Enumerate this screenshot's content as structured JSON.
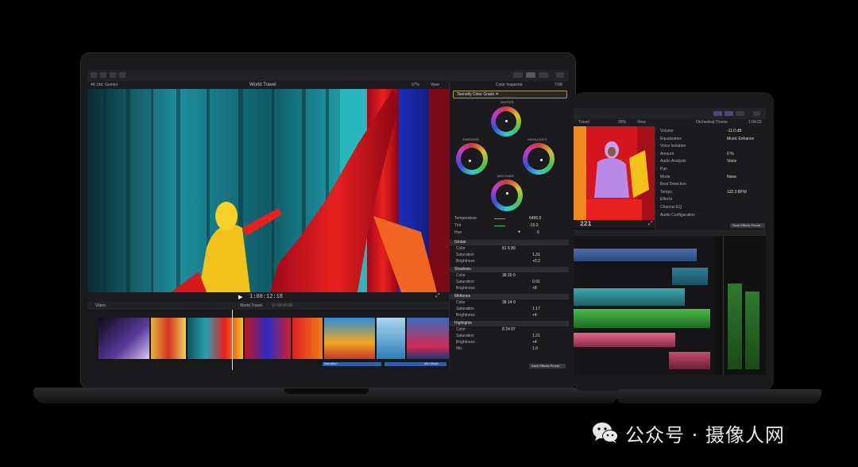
{
  "large_screen": {
    "toolbar": {
      "library": "4K Utd. Gemini",
      "project": "World Travel",
      "zoom": "67%",
      "view": "View",
      "inspector_title": "Color Inspector",
      "inspector_time": "7:08"
    },
    "color_preset": "Teenetly Color Grade ≑",
    "wheels": {
      "master": "MASTER",
      "shadows": "SHADOWS",
      "highlights": "HIGHLIGHTS",
      "midtones": "MIDTONES"
    },
    "params": [
      {
        "label": "Temperature",
        "value": "6495.0"
      },
      {
        "label": "Tint",
        "value": "-15.0"
      },
      {
        "label": "Hue",
        "value": "0"
      }
    ],
    "sections": [
      {
        "title": "Global",
        "rows": [
          {
            "label": "Color",
            "values": "81   6   80"
          },
          {
            "label": "Saturation",
            "values": "1.31"
          },
          {
            "label": "Brightness",
            "values": "+0.2"
          }
        ]
      },
      {
        "title": "Shadows",
        "rows": [
          {
            "label": "Color",
            "values": "38   20   0"
          },
          {
            "label": "Saturation",
            "values": "0.91"
          },
          {
            "label": "Brightness",
            "values": "+8"
          }
        ]
      },
      {
        "title": "Midtones",
        "rows": [
          {
            "label": "Color",
            "values": "38   14   0"
          },
          {
            "label": "Saturation",
            "values": "1.17"
          },
          {
            "label": "Brightness",
            "values": "+4"
          }
        ]
      },
      {
        "title": "Highlights",
        "rows": [
          {
            "label": "Color",
            "values": "8   24   97"
          },
          {
            "label": "Saturation",
            "values": "1.21"
          },
          {
            "label": "Brightness",
            "values": "+4"
          },
          {
            "label": "Mix",
            "values": "1.0"
          }
        ]
      }
    ],
    "save_preset": "Save Effects Preset",
    "timecode": "1:00:12:18",
    "timeline": {
      "label": "Video",
      "project": "World Travel",
      "duration": "27:00:00:00",
      "tag_left": "Narration",
      "tag_right": "Mtn Music"
    }
  },
  "small_screen": {
    "toolbar": {
      "name": "Travel",
      "zoom": "29%",
      "view": "View",
      "title": "Orchestral Theme",
      "time": "1:04:22"
    },
    "inspector_rows": [
      {
        "label": "Volume",
        "value": "-11.0 dB"
      },
      {
        "label": "Equalization",
        "value": "Music Enhance"
      },
      {
        "label": "Voice Isolation",
        "value": ""
      },
      {
        "label": "Amount",
        "value": "0 %"
      },
      {
        "label": "Audio Analysis",
        "value": "Voice"
      },
      {
        "label": "Pan",
        "value": ""
      },
      {
        "label": "Mode",
        "value": "None"
      },
      {
        "label": "Beat Detection",
        "value": ""
      },
      {
        "label": "Tempo",
        "value": "132.0 BPM"
      },
      {
        "label": "Effects",
        "value": ""
      },
      {
        "label": "Channel EQ",
        "value": ""
      },
      {
        "label": "Audio Configuration",
        "value": ""
      }
    ],
    "save_preset": "Save Effects Preset",
    "timecode": "221"
  },
  "watermark": {
    "text": "公众号 · 摄像人网",
    "icon": "wechat-icon"
  }
}
